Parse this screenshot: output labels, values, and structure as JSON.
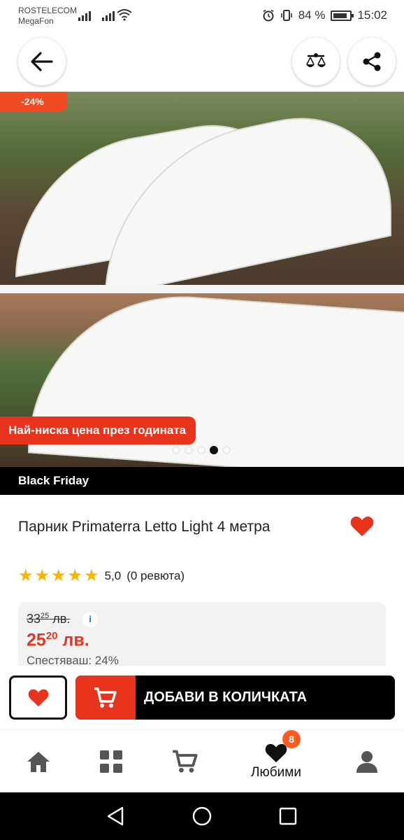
{
  "status_bar": {
    "carrier_1": "ROSTELECOM",
    "carrier_2": "MegaFon",
    "battery": "84 %",
    "time": "15:02"
  },
  "header": {
    "back_icon": "arrow-left-icon",
    "compare_icon": "scales-icon",
    "share_icon": "share-icon"
  },
  "gallery": {
    "discount_badge": "-24%",
    "promo_banner": "Най-ниска цена през годината",
    "dot_count": 5,
    "active_dot": 4
  },
  "campaign_bar": "Black Friday",
  "product": {
    "title": "Парник Primaterra Letto Light 4 метра",
    "rating_value": "5,0",
    "rating_count": "(0 ревюта)",
    "stars": 5
  },
  "price": {
    "old_main": "33",
    "old_cents": "25",
    "old_currency": " лв.",
    "info_icon": "i",
    "new_main": "25",
    "new_cents": "20",
    "new_currency": " лв.",
    "savings": "Спестяваш: 24%"
  },
  "actions": {
    "add_to_cart": "ДОБАВИ В КОЛИЧКАТА"
  },
  "bottom_nav": {
    "items": [
      {
        "icon": "home-icon",
        "label": ""
      },
      {
        "icon": "categories-icon",
        "label": ""
      },
      {
        "icon": "cart-icon",
        "label": ""
      },
      {
        "icon": "heart-icon",
        "label": "Любими",
        "badge": "8"
      },
      {
        "icon": "profile-icon",
        "label": ""
      }
    ]
  },
  "colors": {
    "accent_red": "#e8341c",
    "badge_orange": "#f04b23",
    "star_yellow": "#f7b500"
  }
}
